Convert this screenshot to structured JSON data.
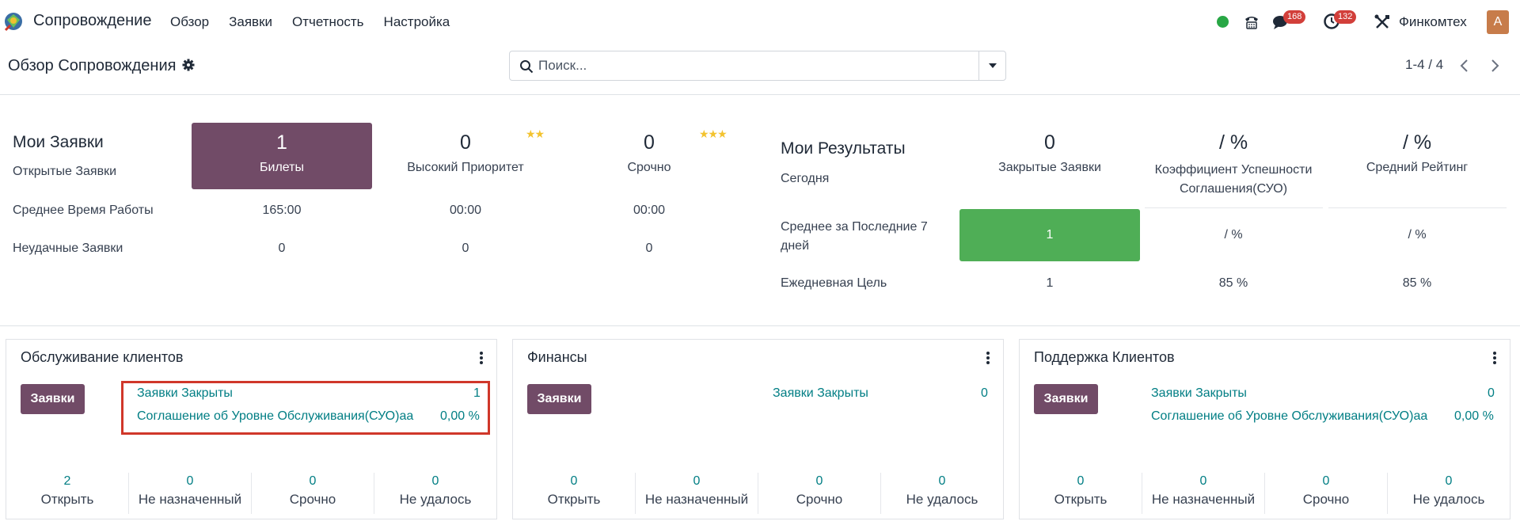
{
  "navbar": {
    "app_name": "Сопровождение",
    "menu": [
      "Обзор",
      "Заявки",
      "Отчетность",
      "Настройка"
    ],
    "messages_count": "168",
    "activities_count": "132",
    "company": "Финкомтех",
    "avatar_letter": "A",
    "status_color": "#28a745"
  },
  "control_panel": {
    "title": "Обзор Сопровождения",
    "search_placeholder": "Поиск...",
    "pager": "1-4 / 4"
  },
  "my_tickets": {
    "title": "Мои Заявки",
    "row_open": "Открытые Заявки",
    "row_avg_time": "Среднее Время Работы",
    "row_failed": "Неудачные Заявки",
    "columns": [
      {
        "count": "1",
        "label": "Билеты",
        "avg_time": "165:00",
        "failed": "0",
        "stars": ""
      },
      {
        "count": "0",
        "label": "Высокий Приоритет",
        "avg_time": "00:00",
        "failed": "0",
        "stars": "★★"
      },
      {
        "count": "0",
        "label": "Срочно",
        "avg_time": "00:00",
        "failed": "0",
        "stars": "★★★"
      }
    ]
  },
  "my_results": {
    "title": "Мои Результаты",
    "row_today": "Сегодня",
    "row_avg7": "Среднее за Последние 7 дней",
    "row_goal": "Ежедневная Цель",
    "columns": [
      {
        "today": "0",
        "label": "Закрытые Заявки",
        "avg7": "1",
        "goal": "1"
      },
      {
        "today": "/ %",
        "label": "Коэффициент Успешности Соглашения(СУО)",
        "avg7": "/ %",
        "goal": "85 %"
      },
      {
        "today": "/ %",
        "label": "Средний Рейтинг",
        "avg7": "/ %",
        "goal": "85 %"
      }
    ]
  },
  "teams": [
    {
      "name": "Обслуживание клиентов",
      "button": "Заявки",
      "closed_label": "Заявки Закрыты",
      "closed_value": "1",
      "sla_label": "Соглашение об Уровне Обслуживания(СУО)аа",
      "sla_value": "0,00 %",
      "stats": [
        {
          "value": "2",
          "label": "Открыть"
        },
        {
          "value": "0",
          "label": "Не назначенный"
        },
        {
          "value": "0",
          "label": "Срочно"
        },
        {
          "value": "0",
          "label": "Не удалось"
        }
      ]
    },
    {
      "name": "Финансы",
      "button": "Заявки",
      "closed_label": "Заявки Закрыты",
      "closed_value": "0",
      "stats": [
        {
          "value": "0",
          "label": "Открыть"
        },
        {
          "value": "0",
          "label": "Не назначенный"
        },
        {
          "value": "0",
          "label": "Срочно"
        },
        {
          "value": "0",
          "label": "Не удалось"
        }
      ]
    },
    {
      "name": "Поддержка Клиентов",
      "button": "Заявки",
      "closed_label": "Заявки Закрыты",
      "closed_value": "0",
      "sla_label": "Соглашение об Уровне Обслуживания(СУО)аа",
      "sla_value": "0,00 %",
      "stats": [
        {
          "value": "0",
          "label": "Открыть"
        },
        {
          "value": "0",
          "label": "Не назначенный"
        },
        {
          "value": "0",
          "label": "Срочно"
        },
        {
          "value": "0",
          "label": "Не удалось"
        }
      ]
    }
  ],
  "colors": {
    "brand": "#714b67",
    "success": "#4fae56",
    "link": "#017e84",
    "badge": "#d23f3a",
    "highlight_border": "#d0372a"
  }
}
